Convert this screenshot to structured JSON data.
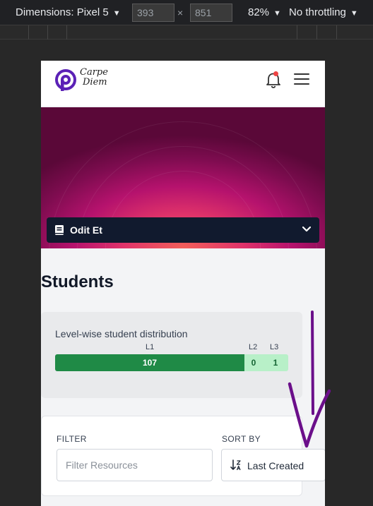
{
  "devtools": {
    "device_label": "Dimensions: Pixel 5",
    "width_value": "393",
    "height_value": "851",
    "times_glyph": "×",
    "zoom": "82%",
    "throttling": "No throttling",
    "caret": "▼"
  },
  "app": {
    "logo_line1": "Carpe",
    "logo_line2": "Diem",
    "brand_color": "#5b21b6",
    "notification_dot_color": "#ef4444"
  },
  "course_selector": {
    "selected": "Odit Et"
  },
  "students": {
    "title": "Students"
  },
  "distribution": {
    "caption": "Level-wise student distribution",
    "levels": [
      {
        "label": "L1",
        "count": "107",
        "color": "#1f8a46"
      },
      {
        "label": "L2",
        "count": "0",
        "color": "#b8f0c8"
      },
      {
        "label": "L3",
        "count": "1",
        "color": "#b8f0c8"
      }
    ]
  },
  "filters": {
    "filter_label": "FILTER",
    "filter_placeholder": "Filter Resources",
    "sort_label": "SORT BY",
    "sort_value": "Last Created"
  },
  "annotation_color": "#6b0f8a"
}
